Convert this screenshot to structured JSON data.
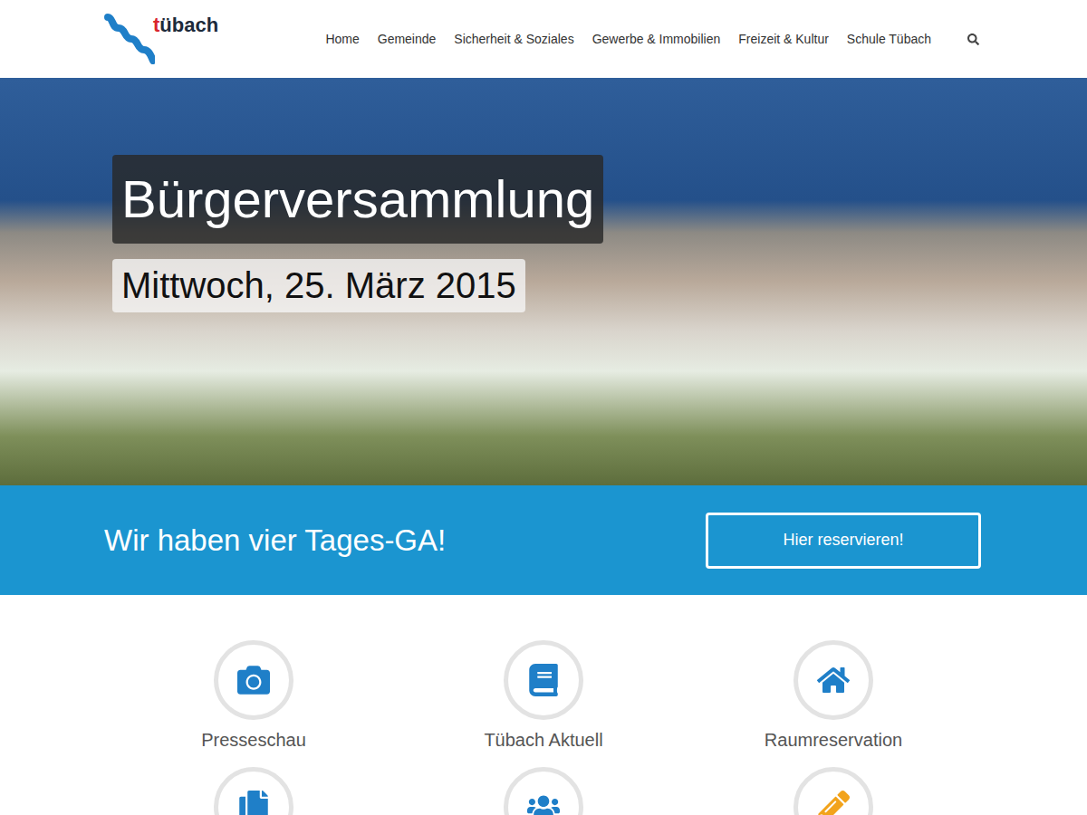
{
  "logo": {
    "accent": "t",
    "rest": "übach"
  },
  "nav": [
    {
      "label": "Home"
    },
    {
      "label": "Gemeinde"
    },
    {
      "label": "Sicherheit & Soziales"
    },
    {
      "label": "Gewerbe & Immobilien"
    },
    {
      "label": "Freizeit & Kultur"
    },
    {
      "label": "Schule Tübach"
    }
  ],
  "hero": {
    "title": "Bürgerversammlung",
    "date": "Mittwoch, 25. März 2015"
  },
  "banner": {
    "text": "Wir haben vier Tages-GA!",
    "button": "Hier reservieren!"
  },
  "tiles": [
    {
      "kind": "camera",
      "label": "Presseschau",
      "color": "#1f7fc8"
    },
    {
      "kind": "book",
      "label": "Tübach Aktuell",
      "color": "#1f7fc8"
    },
    {
      "kind": "home",
      "label": "Raumreservation",
      "color": "#1f7fc8"
    },
    {
      "kind": "document",
      "label": "",
      "color": "#1f7fc8"
    },
    {
      "kind": "users",
      "label": "",
      "color": "#1f7fc8"
    },
    {
      "kind": "pencil",
      "label": "",
      "color": "#f2a31b"
    }
  ]
}
